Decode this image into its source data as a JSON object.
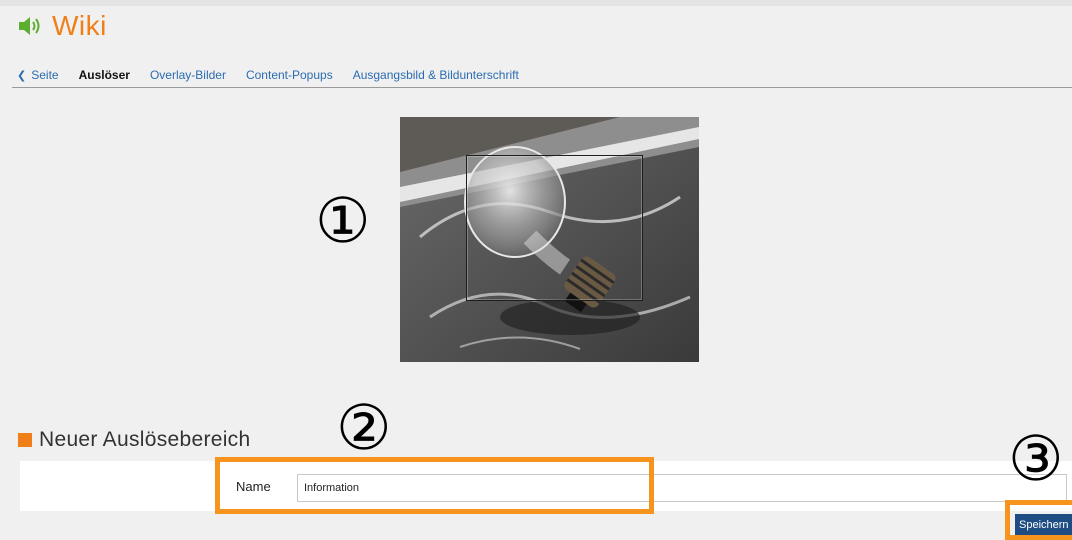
{
  "header": {
    "title": "Wiki",
    "icon": "speaker-icon",
    "accent_color": "#f07f19"
  },
  "tabs": {
    "back_icon": "chevron-left-icon",
    "items": [
      {
        "label": "Seite",
        "active": false
      },
      {
        "label": "Auslöser",
        "active": true
      },
      {
        "label": "Overlay-Bilder",
        "active": false
      },
      {
        "label": "Content-Popups",
        "active": false
      },
      {
        "label": "Ausgangsbild & Bildunterschrift",
        "active": false
      }
    ]
  },
  "callouts": [
    "①",
    "②",
    "③"
  ],
  "section": {
    "title": "Neuer Auslösebereich"
  },
  "form": {
    "name_label": "Name",
    "name_value": "Information",
    "save_label": "Speichern"
  },
  "colors": {
    "highlight": "#f6941e",
    "button": "#1d4d82",
    "link": "#2b6cb0"
  }
}
